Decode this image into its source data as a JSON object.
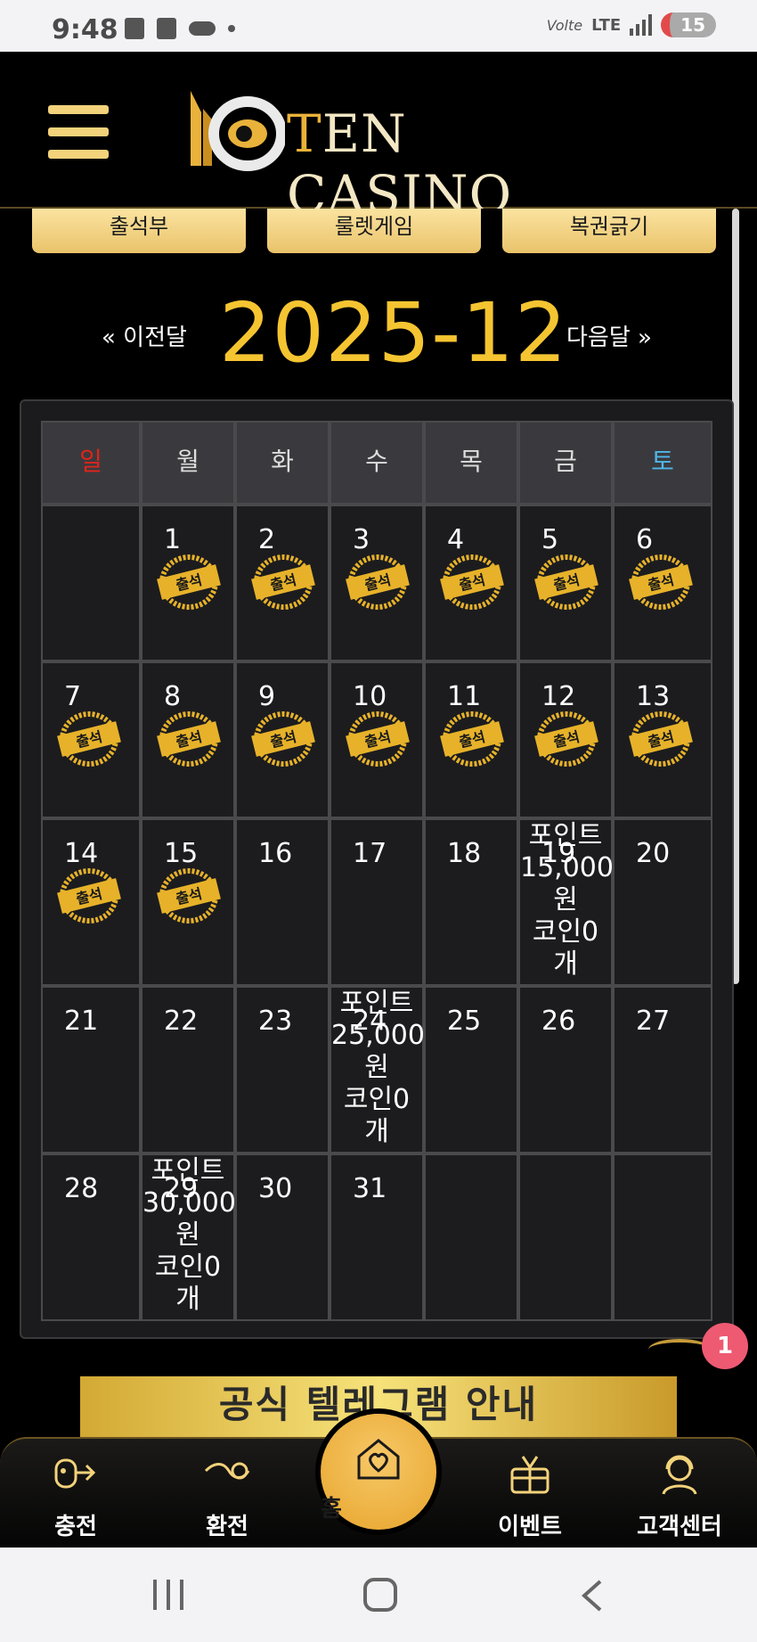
{
  "status_bar": {
    "time": "9:48",
    "volte": "Volte",
    "network": "LTE",
    "battery": "15"
  },
  "header": {
    "brand_first": "T",
    "brand_rest": "EN CASINO"
  },
  "tabs": [
    "출석부",
    "룰렛게임",
    "복권긁기"
  ],
  "month_nav": {
    "prev_label": "« 이전달",
    "title": "2025-12",
    "next_label": "다음달 »"
  },
  "calendar": {
    "weekdays": [
      "일",
      "월",
      "화",
      "수",
      "목",
      "금",
      "토"
    ],
    "weeks": [
      [
        "",
        "1",
        "2",
        "3",
        "4",
        "5",
        "6"
      ],
      [
        "7",
        "8",
        "9",
        "10",
        "11",
        "12",
        "13"
      ],
      [
        "14",
        "15",
        "16",
        "17",
        "18",
        "19",
        "20"
      ],
      [
        "21",
        "22",
        "23",
        "24",
        "25",
        "26",
        "27"
      ],
      [
        "28",
        "29",
        "30",
        "31",
        "",
        "",
        ""
      ]
    ],
    "stamp_label": "출석",
    "attended_days": [
      "1",
      "2",
      "3",
      "4",
      "5",
      "6",
      "7",
      "8",
      "9",
      "10",
      "11",
      "12",
      "13",
      "14",
      "15"
    ],
    "rewards": [
      {
        "day": "19",
        "lines": [
          "포인트",
          "15,000",
          "원",
          "코인0",
          "개"
        ]
      },
      {
        "day": "24",
        "lines": [
          "포인트",
          "25,000",
          "원",
          "코인0",
          "개"
        ]
      },
      {
        "day": "29",
        "lines": [
          "포인트",
          "30,000",
          "원",
          "코인0",
          "개"
        ]
      }
    ]
  },
  "chat_badge": "1",
  "telegram_banner": "공식 텔레그램 안내",
  "bottom_nav": {
    "charge": "충전",
    "exchange": "환전",
    "home": "홈",
    "event": "이벤트",
    "support": "고객센터"
  },
  "colors": {
    "gold": "#f5c431",
    "sunday": "#e0241a",
    "saturday": "#4fb7e8"
  }
}
